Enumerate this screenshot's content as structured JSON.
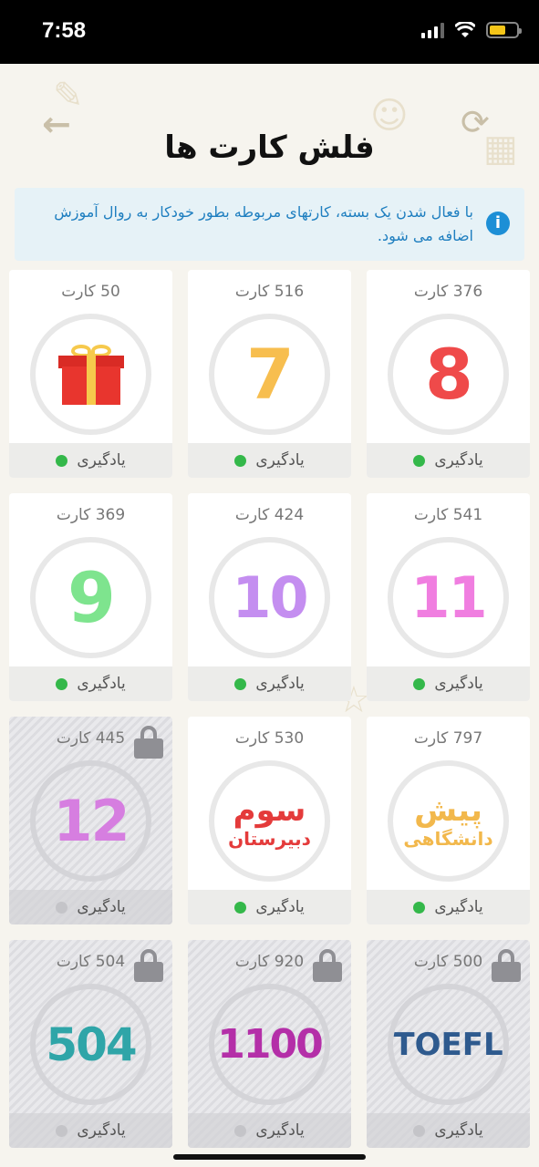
{
  "status_bar": {
    "time": "7:58"
  },
  "header": {
    "title": "فلش کارت ها"
  },
  "info": {
    "text": "با فعال شدن یک بسته، کارتهای مربوطه بطور خودکار به روال آموزش اضافه می شود."
  },
  "cards": [
    {
      "count": "376 کارت",
      "label": "8",
      "color": "#ef4a4a",
      "status": "یادگیری",
      "locked": false,
      "active": true
    },
    {
      "count": "516 کارت",
      "label": "7",
      "color": "#f7be4f",
      "status": "یادگیری",
      "locked": false,
      "active": true
    },
    {
      "count": "50 کارت",
      "label": "gift",
      "color": "#e8352e",
      "status": "یادگیری",
      "locked": false,
      "active": true
    },
    {
      "count": "541 کارت",
      "label": "11",
      "color": "#f07ee0",
      "status": "یادگیری",
      "locked": false,
      "active": true
    },
    {
      "count": "424 کارت",
      "label": "10",
      "color": "#c48ef0",
      "status": "یادگیری",
      "locked": false,
      "active": true
    },
    {
      "count": "369 کارت",
      "label": "9",
      "color": "#7ee48e",
      "status": "یادگیری",
      "locked": false,
      "active": true
    },
    {
      "count": "797 کارت",
      "label": "پیش",
      "sublabel": "دانشگاهی",
      "color": "#f2b84c",
      "status": "یادگیری",
      "locked": false,
      "active": true
    },
    {
      "count": "530 کارت",
      "label": "سوم",
      "sublabel": "دبیرستان",
      "color": "#e43b3b",
      "status": "یادگیری",
      "locked": false,
      "active": true
    },
    {
      "count": "445 کارت",
      "label": "12",
      "color": "#d67ee0",
      "status": "یادگیری",
      "locked": true,
      "active": false
    },
    {
      "count": "500 کارت",
      "label": "TOEFL",
      "color": "#2e5a8e",
      "status": "یادگیری",
      "locked": true,
      "active": false
    },
    {
      "count": "920 کارت",
      "label": "1100",
      "color": "#b42fa8",
      "status": "یادگیری",
      "locked": true,
      "active": false
    },
    {
      "count": "504 کارت",
      "label": "504",
      "color": "#2fa5a8",
      "status": "یادگیری",
      "locked": true,
      "active": false
    }
  ]
}
